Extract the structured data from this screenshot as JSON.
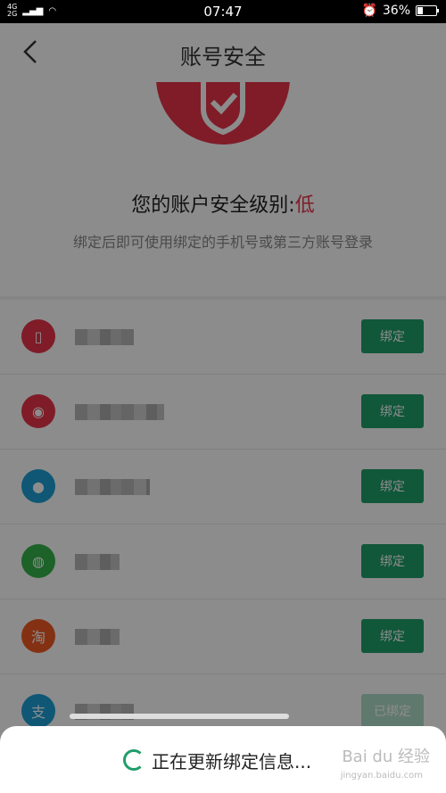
{
  "status_bar": {
    "network_top": "4G",
    "network_bottom": "2G",
    "time": "07:47",
    "battery": "36%"
  },
  "header": {
    "title": "账号安全"
  },
  "hero": {
    "level_prefix": "您的账户安全级别:",
    "level_value": "低",
    "hint": "绑定后即可使用绑定的手机号或第三方账号登录"
  },
  "accounts": [
    {
      "icon": "phone-icon",
      "icon_color": "#e8334a",
      "button": "绑定",
      "blur_width": 66
    },
    {
      "icon": "weibo-icon",
      "icon_color": "#e8334a",
      "button": "绑定",
      "blur_width": 100
    },
    {
      "icon": "qq-icon",
      "icon_color": "#1e9fd7",
      "button": "绑定",
      "blur_width": 84
    },
    {
      "icon": "wechat-icon",
      "icon_color": "#36b34a",
      "button": "绑定",
      "blur_width": 50
    },
    {
      "icon": "taobao-icon",
      "icon_color": "#f05a23",
      "icon_text": "淘",
      "button": "绑定",
      "blur_width": 50
    },
    {
      "icon": "alipay-icon",
      "icon_color": "#1e9fd7",
      "button": "已绑定",
      "blur_width": 66
    }
  ],
  "toast": {
    "text": "正在更新绑定信息...",
    "watermark": "Bai du 经验",
    "watermark_url": "jingyan.baidu.com"
  },
  "colors": {
    "accent": "#1f9e6a",
    "danger": "#e8334a"
  }
}
